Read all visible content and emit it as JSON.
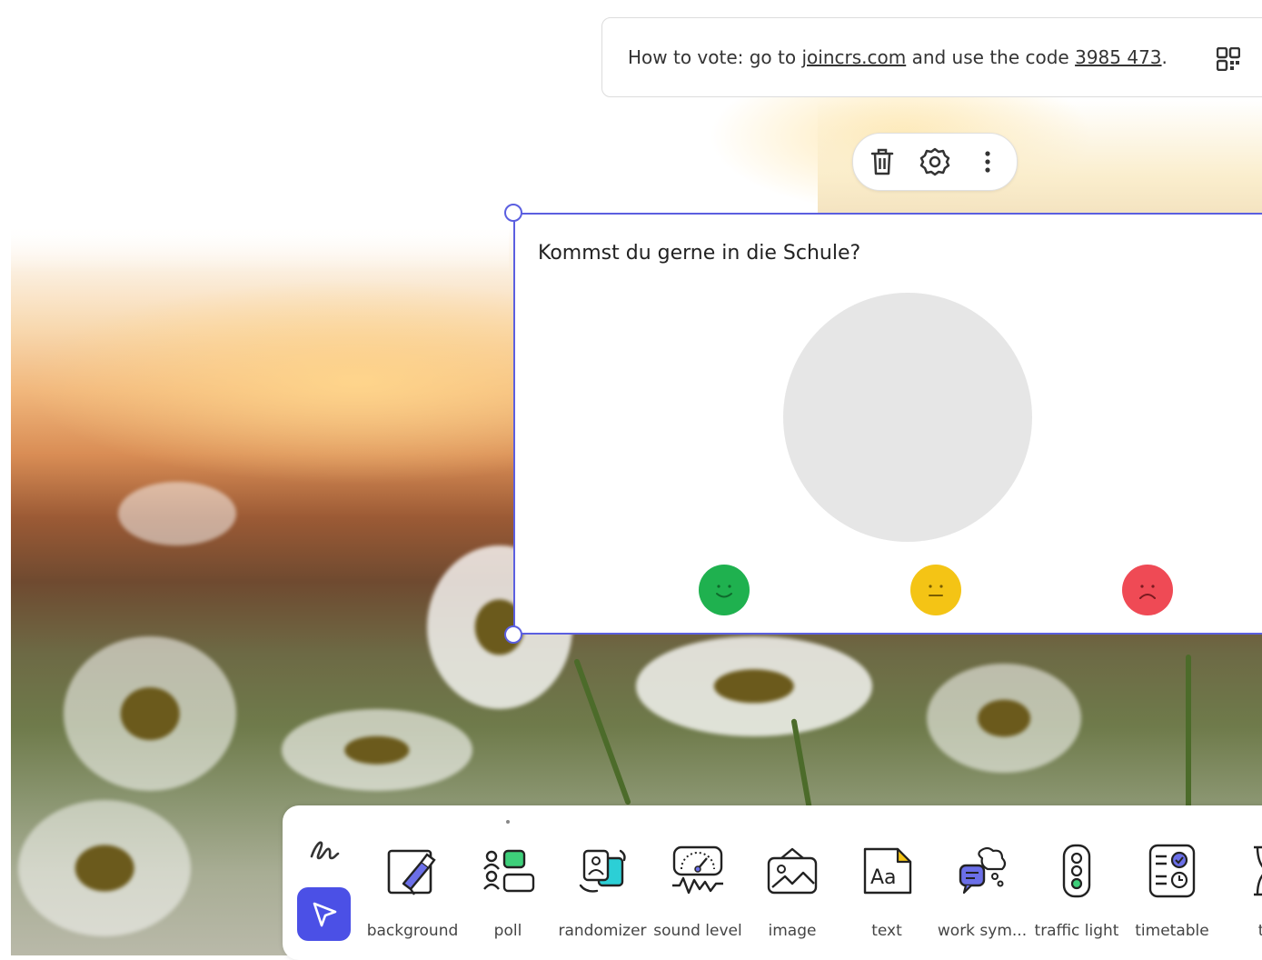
{
  "vote_banner": {
    "prefix": "How to vote: go to ",
    "site": "joincrs.com",
    "middle": " and use the code ",
    "code": "3985 473",
    "suffix": ".",
    "qr_icon": "qr-code-icon"
  },
  "widget_toolbar": {
    "icons": [
      "trash-icon",
      "gear-icon",
      "more-vertical-icon"
    ]
  },
  "poll": {
    "question": "Kommst du gerne in die Schule?",
    "options": [
      {
        "icon": "happy-face-icon",
        "color": "#1fb14f"
      },
      {
        "icon": "neutral-face-icon",
        "color": "#f4c415"
      },
      {
        "icon": "sad-face-icon",
        "color": "#ef4a55"
      }
    ],
    "pie_color": "#e6e6e6",
    "accent": "#5b5fe0"
  },
  "toolbar": {
    "pen_icon": "pen-scribble-icon",
    "select_icon": "cursor-arrow-icon",
    "items": [
      {
        "label": "background",
        "icon": "background-brush-icon"
      },
      {
        "label": "poll",
        "icon": "poll-icon"
      },
      {
        "label": "randomizer",
        "icon": "randomizer-icon"
      },
      {
        "label": "sound level",
        "icon": "sound-level-icon"
      },
      {
        "label": "image",
        "icon": "image-icon"
      },
      {
        "label": "text",
        "icon": "text-icon"
      },
      {
        "label": "work sym...",
        "icon": "work-symbols-icon"
      },
      {
        "label": "traffic light",
        "icon": "traffic-light-icon"
      },
      {
        "label": "timetable",
        "icon": "timetable-icon"
      },
      {
        "label": "tir",
        "icon": "timer-icon"
      }
    ],
    "select_color": "#4b50e6"
  }
}
